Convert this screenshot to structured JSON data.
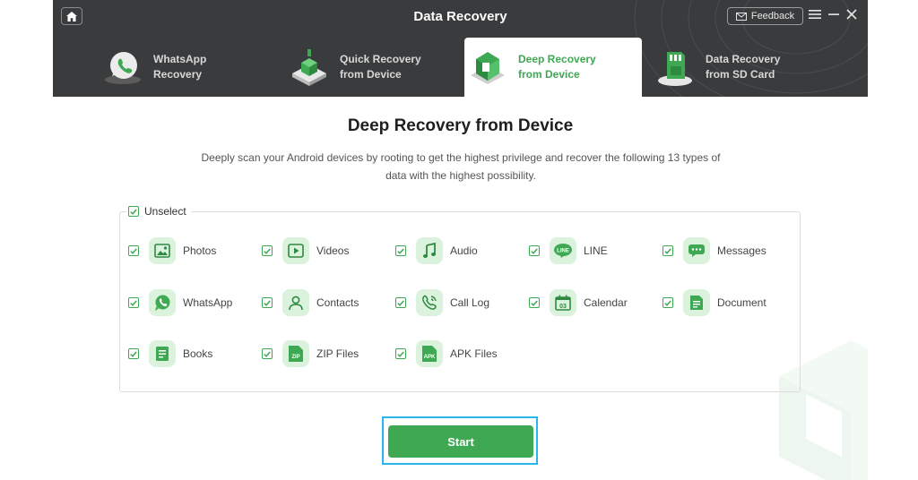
{
  "app": {
    "title": "Data Recovery"
  },
  "header": {
    "feedback_label": "Feedback"
  },
  "tabs": [
    {
      "label": "WhatsApp\nRecovery",
      "active": false,
      "icon": "whatsapp-recovery-icon"
    },
    {
      "label": "Quick Recovery\nfrom Device",
      "active": false,
      "icon": "quick-recovery-icon"
    },
    {
      "label": "Deep Recovery\nfrom Device",
      "active": true,
      "icon": "deep-recovery-icon"
    },
    {
      "label": "Data Recovery\nfrom SD Card",
      "active": false,
      "icon": "sd-card-icon"
    }
  ],
  "main": {
    "title": "Deep Recovery from Device",
    "description": "Deeply scan your Android devices by rooting to get the highest privilege and recover the following 13 types of data with the highest possibility.",
    "unselect_label": "Unselect",
    "items": [
      {
        "label": "Photos",
        "icon": "photos-icon",
        "checked": true
      },
      {
        "label": "Videos",
        "icon": "videos-icon",
        "checked": true
      },
      {
        "label": "Audio",
        "icon": "audio-icon",
        "checked": true
      },
      {
        "label": "LINE",
        "icon": "line-icon",
        "icon_text": "LINE",
        "checked": true
      },
      {
        "label": "Messages",
        "icon": "messages-icon",
        "checked": true
      },
      {
        "label": "WhatsApp",
        "icon": "whatsapp-icon",
        "checked": true
      },
      {
        "label": "Contacts",
        "icon": "contacts-icon",
        "checked": true
      },
      {
        "label": "Call Log",
        "icon": "call-log-icon",
        "checked": true
      },
      {
        "label": "Calendar",
        "icon": "calendar-icon",
        "icon_text": "03",
        "checked": true
      },
      {
        "label": "Document",
        "icon": "document-icon",
        "checked": true
      },
      {
        "label": "Books",
        "icon": "books-icon",
        "checked": true
      },
      {
        "label": "ZIP Files",
        "icon": "zip-files-icon",
        "icon_text": "ZIP",
        "checked": true
      },
      {
        "label": "APK Files",
        "icon": "apk-files-icon",
        "icon_text": "APK",
        "checked": true
      }
    ],
    "start_label": "Start"
  },
  "colors": {
    "accent": "#3ea853",
    "header_bg": "#3a3b3c",
    "icon_bg": "#dbf2dd",
    "focus": "#29b6e8"
  }
}
